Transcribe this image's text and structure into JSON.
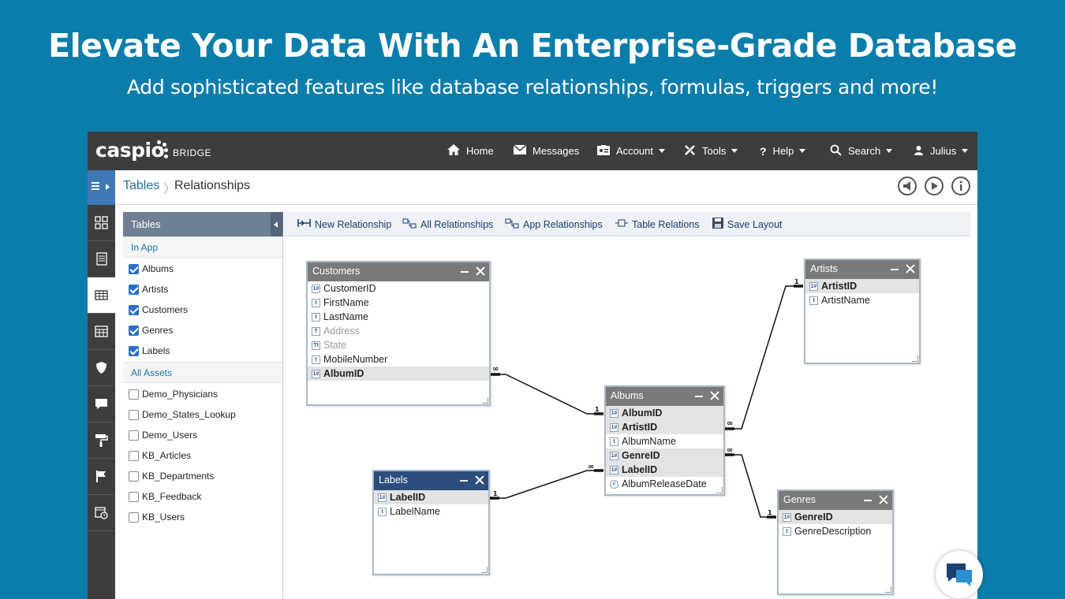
{
  "hero": {
    "title": "Elevate Your Data With An Enterprise-Grade Database",
    "subtitle": "Add sophisticated features like database relationships, formulas, triggers and more!"
  },
  "brand": {
    "logo": "caspio",
    "product": "BRIDGE"
  },
  "nav": {
    "home": "Home",
    "messages": "Messages",
    "account": "Account",
    "tools": "Tools",
    "help": "Help",
    "search": "Search",
    "user": "Julius"
  },
  "breadcrumb": {
    "parent": "Tables",
    "separator": "〉",
    "current": "Relationships"
  },
  "tables_panel": {
    "title": "Tables",
    "in_app_label": "In App",
    "in_app": [
      {
        "name": "Albums",
        "checked": true
      },
      {
        "name": "Artists",
        "checked": true
      },
      {
        "name": "Customers",
        "checked": true
      },
      {
        "name": "Genres",
        "checked": true
      },
      {
        "name": "Labels",
        "checked": true
      }
    ],
    "all_assets_label": "All Assets",
    "all_assets": [
      {
        "name": "Demo_Physicians",
        "checked": false
      },
      {
        "name": "Demo_States_Lookup",
        "checked": false
      },
      {
        "name": "Demo_Users",
        "checked": false
      },
      {
        "name": "KB_Articles",
        "checked": false
      },
      {
        "name": "KB_Departments",
        "checked": false
      },
      {
        "name": "KB_Feedback",
        "checked": false
      },
      {
        "name": "KB_Users",
        "checked": false
      }
    ]
  },
  "toolbar": {
    "new_relationship": "New Relationship",
    "all_relationships": "All Relationships",
    "app_relationships": "App Relationships",
    "table_relations": "Table Relations",
    "save_layout": "Save Layout"
  },
  "diagram": {
    "customers": {
      "title": "Customers",
      "fields": [
        "CustomerID",
        "FirstName",
        "LastName",
        "Address",
        "State",
        "MobileNumber",
        "AlbumID"
      ]
    },
    "artists": {
      "title": "Artists",
      "fields": [
        "ArtistID",
        "ArtistName"
      ]
    },
    "albums": {
      "title": "Albums",
      "fields": [
        "AlbumID",
        "ArtistID",
        "AlbumName",
        "GenreID",
        "LabelID",
        "AlbumReleaseDate"
      ]
    },
    "labels": {
      "title": "Labels",
      "fields": [
        "LabelID",
        "LabelName"
      ]
    },
    "genres": {
      "title": "Genres",
      "fields": [
        "GenreID",
        "GenreDescription"
      ]
    },
    "one_label": "1",
    "many_label": "∞"
  },
  "colors": {
    "background": "#0b7dab",
    "topbar": "#3d3d3d",
    "accent": "#3f78b5"
  }
}
